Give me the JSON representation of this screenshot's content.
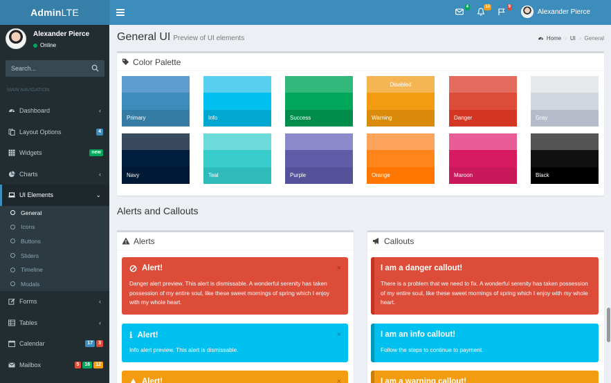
{
  "logo": {
    "bold": "Admin",
    "light": "LTE"
  },
  "header": {
    "mail_badge": "4",
    "notif_badge": "10",
    "flag_badge": "9",
    "user_name": "Alexander Pierce",
    "colors": {
      "mail": "#00a65a",
      "notif": "#f39c12",
      "flag": "#dd4b39"
    }
  },
  "sidebar": {
    "user_name": "Alexander Pierce",
    "status": "Online",
    "search_placeholder": "Search...",
    "nav_header": "MAIN NAVIGATION",
    "items": [
      {
        "label": "Dashboard",
        "icon": "dashboard-icon"
      },
      {
        "label": "Layout Options",
        "icon": "files-icon",
        "badge": "4"
      },
      {
        "label": "Widgets",
        "icon": "th-icon",
        "badge": "new"
      },
      {
        "label": "Charts",
        "icon": "pie-chart-icon"
      },
      {
        "label": "UI Elements",
        "icon": "laptop-icon"
      },
      {
        "label": "Forms",
        "icon": "edit-icon"
      },
      {
        "label": "Tables",
        "icon": "table-icon"
      },
      {
        "label": "Calendar",
        "icon": "calendar-icon",
        "badges": [
          "17",
          "3"
        ]
      },
      {
        "label": "Mailbox",
        "icon": "envelope-icon",
        "badges": [
          "5",
          "16",
          "12"
        ]
      }
    ],
    "subitems": [
      "General",
      "Icons",
      "Buttons",
      "Sliders",
      "Timeline",
      "Modals"
    ]
  },
  "page": {
    "title": "General UI",
    "subtitle": "Preview of UI elements",
    "breadcrumb": [
      "Home",
      "UI",
      "General"
    ]
  },
  "palette": {
    "title": "Color Palette",
    "swatches": [
      {
        "label": "Primary",
        "colors": [
          "#5d9ccc",
          "#3c8dbc",
          "#357ca5"
        ]
      },
      {
        "label": "Info",
        "colors": [
          "#5ad0f0",
          "#00c0ef",
          "#00a7d0"
        ]
      },
      {
        "label": "Success",
        "colors": [
          "#33b87b",
          "#00a65a",
          "#008d4c"
        ]
      },
      {
        "label": "Warning",
        "top_text": "Disabled",
        "colors": [
          "#f5b553",
          "#f39c12",
          "#db8b0b"
        ]
      },
      {
        "label": "Danger",
        "colors": [
          "#e46c5f",
          "#dd4b39",
          "#d33724"
        ]
      },
      {
        "label": "Gray",
        "colors": [
          "#e6e8ec",
          "#d2d6de",
          "#b5bbc8"
        ]
      },
      {
        "label": "Navy",
        "colors": [
          "#3a4a5e",
          "#001f3f",
          "#001a35"
        ]
      },
      {
        "label": "Teal",
        "colors": [
          "#6cdad9",
          "#39cccc",
          "#30bbbb"
        ]
      },
      {
        "label": "Purple",
        "colors": [
          "#8d8acb",
          "#605ca8",
          "#555299"
        ]
      },
      {
        "label": "Orange",
        "colors": [
          "#ffa45c",
          "#ff851b",
          "#ff7701"
        ]
      },
      {
        "label": "Maroon",
        "colors": [
          "#e85d97",
          "#d81b60",
          "#ca195a"
        ]
      },
      {
        "label": "Black",
        "colors": [
          "#555555",
          "#111111",
          "#000000"
        ]
      }
    ]
  },
  "alerts_section_title": "Alerts and Callouts",
  "alerts": {
    "title": "Alerts",
    "items": [
      {
        "title": "Alert!",
        "text": "Danger alert preview. This alert is dismissable. A wonderful serenity has taken possession of my entire soul, like these sweet mornings of spring which I enjoy with my whole heart.",
        "color": "#dd4b39",
        "icon": "ban-icon"
      },
      {
        "title": "Alert!",
        "text": "Info alert preview. This alert is dismissable.",
        "color": "#00c0ef",
        "icon": "info-icon"
      },
      {
        "title": "Alert!",
        "text": "",
        "color": "#f39c12",
        "icon": "warning-icon"
      }
    ]
  },
  "callouts": {
    "title": "Callouts",
    "items": [
      {
        "title": "I am a danger callout!",
        "text": "There is a problem that we need to fix. A wonderful serenity has taken possession of my entire soul, like these sweet mornings of spring which I enjoy with my whole heart.",
        "color": "#dd4b39",
        "border": "#c23321"
      },
      {
        "title": "I am an info callout!",
        "text": "Follow the steps to continue to payment.",
        "color": "#00c0ef",
        "border": "#0097bc"
      },
      {
        "title": "I am a warning callout!",
        "text": "",
        "color": "#f39c12",
        "border": "#c87f0a"
      }
    ]
  }
}
